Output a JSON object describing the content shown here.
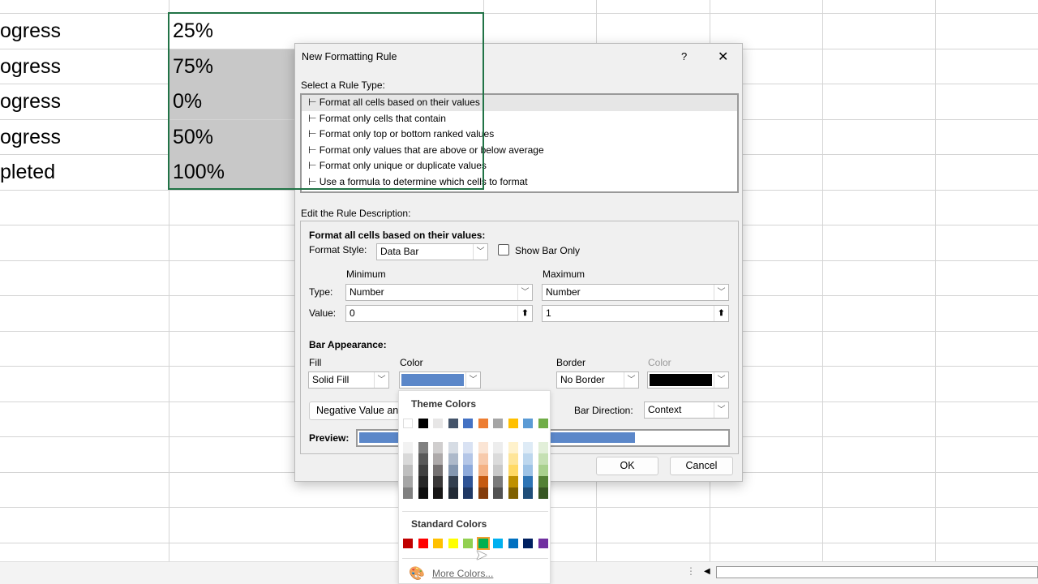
{
  "sheet": {
    "col_a": [
      "ogress",
      "ogress",
      "ogress",
      "ogress",
      "pleted"
    ],
    "col_b": [
      "25%",
      "75%",
      "0%",
      "50%",
      "100%"
    ],
    "fill_color": "#c8c8c8",
    "selection_color": "#217346"
  },
  "dialog": {
    "title": "New Formatting Rule",
    "help": "?",
    "close": "✕",
    "rule_type_label": "Select a Rule Type:",
    "rule_types": [
      "Format all cells based on their values",
      "Format only cells that contain",
      "Format only top or bottom ranked values",
      "Format only values that are above or below average",
      "Format only unique or duplicate values",
      "Use a formula to determine which cells to format"
    ],
    "edit_label": "Edit the Rule Description:",
    "desc_heading": "Format all cells based on their values:",
    "format_style_label": "Format Style:",
    "format_style": "Data Bar",
    "show_bar_only": "Show Bar Only",
    "minimum": "Minimum",
    "maximum": "Maximum",
    "type_label": "Type:",
    "value_label": "Value:",
    "min_type": "Number",
    "max_type": "Number",
    "min_value": "0",
    "max_value": "1",
    "bar_appearance": "Bar Appearance:",
    "fill_label": "Fill",
    "color_label": "Color",
    "fill_value": "Solid Fill",
    "bar_color": "#5b87c9",
    "border_label": "Border",
    "border_color_label": "Color",
    "border_value": "No Border",
    "border_color": "#000000",
    "negative_button": "Negative Value an",
    "bar_direction_label": "Bar Direction:",
    "bar_direction": "Context",
    "preview_label": "Preview:",
    "ok": "OK",
    "cancel": "Cancel"
  },
  "palette": {
    "theme_title": "Theme Colors",
    "theme": [
      "#ffffff",
      "#000000",
      "#e7e6e6",
      "#44546a",
      "#4472c4",
      "#ed7d31",
      "#a5a5a5",
      "#ffc000",
      "#5b9bd5",
      "#70ad47"
    ],
    "shades": [
      [
        "#f2f2f2",
        "#d9d9d9",
        "#bfbfbf",
        "#a6a6a6",
        "#808080"
      ],
      [
        "#808080",
        "#595959",
        "#404040",
        "#262626",
        "#0d0d0d"
      ],
      [
        "#d0cece",
        "#aeaaaa",
        "#757171",
        "#3a3838",
        "#171616"
      ],
      [
        "#d6dce4",
        "#adb9ca",
        "#8497b0",
        "#333f4f",
        "#222a35"
      ],
      [
        "#d9e2f3",
        "#b4c6e7",
        "#8eaadb",
        "#2f5496",
        "#1f3864"
      ],
      [
        "#fbe5d5",
        "#f7caac",
        "#f4b183",
        "#c55a11",
        "#843c0b"
      ],
      [
        "#ededed",
        "#dbdbdb",
        "#c9c9c9",
        "#7b7b7b",
        "#525252"
      ],
      [
        "#fff2cc",
        "#fee599",
        "#ffd965",
        "#bf9000",
        "#7f6000"
      ],
      [
        "#deebf6",
        "#bdd7ee",
        "#9dc3e6",
        "#2e75b5",
        "#1f4e79"
      ],
      [
        "#e2efd9",
        "#c5e0b3",
        "#a8d08d",
        "#538135",
        "#375623"
      ]
    ],
    "standard_title": "Standard Colors",
    "standard": [
      "#c00000",
      "#ff0000",
      "#ffc000",
      "#ffff00",
      "#92d050",
      "#00b050",
      "#00b0f0",
      "#0070c0",
      "#002060",
      "#7030a0"
    ],
    "selected_standard": 5,
    "more_colors": "More Colors..."
  }
}
